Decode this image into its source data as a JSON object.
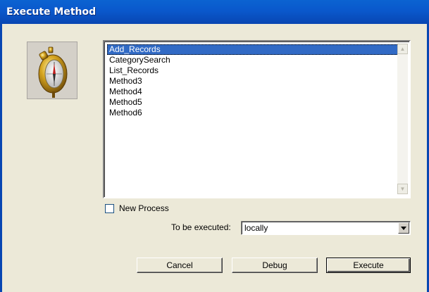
{
  "window": {
    "title": "Execute Method"
  },
  "icon": {
    "name": "compass-icon"
  },
  "methods": {
    "items": [
      "Add_Records",
      "CategorySearch",
      "List_Records",
      "Method3",
      "Method4",
      "Method5",
      "Method6"
    ],
    "selected_index": 0
  },
  "options": {
    "new_process_label": "New Process",
    "new_process_checked": false,
    "execute_location_label": "To be executed:",
    "execute_location_value": "locally"
  },
  "buttons": {
    "cancel": "Cancel",
    "debug": "Debug",
    "execute": "Execute"
  },
  "colors": {
    "titlebar": "#0a58cc",
    "selection": "#316ac5",
    "dialog_bg": "#ece9d8"
  }
}
